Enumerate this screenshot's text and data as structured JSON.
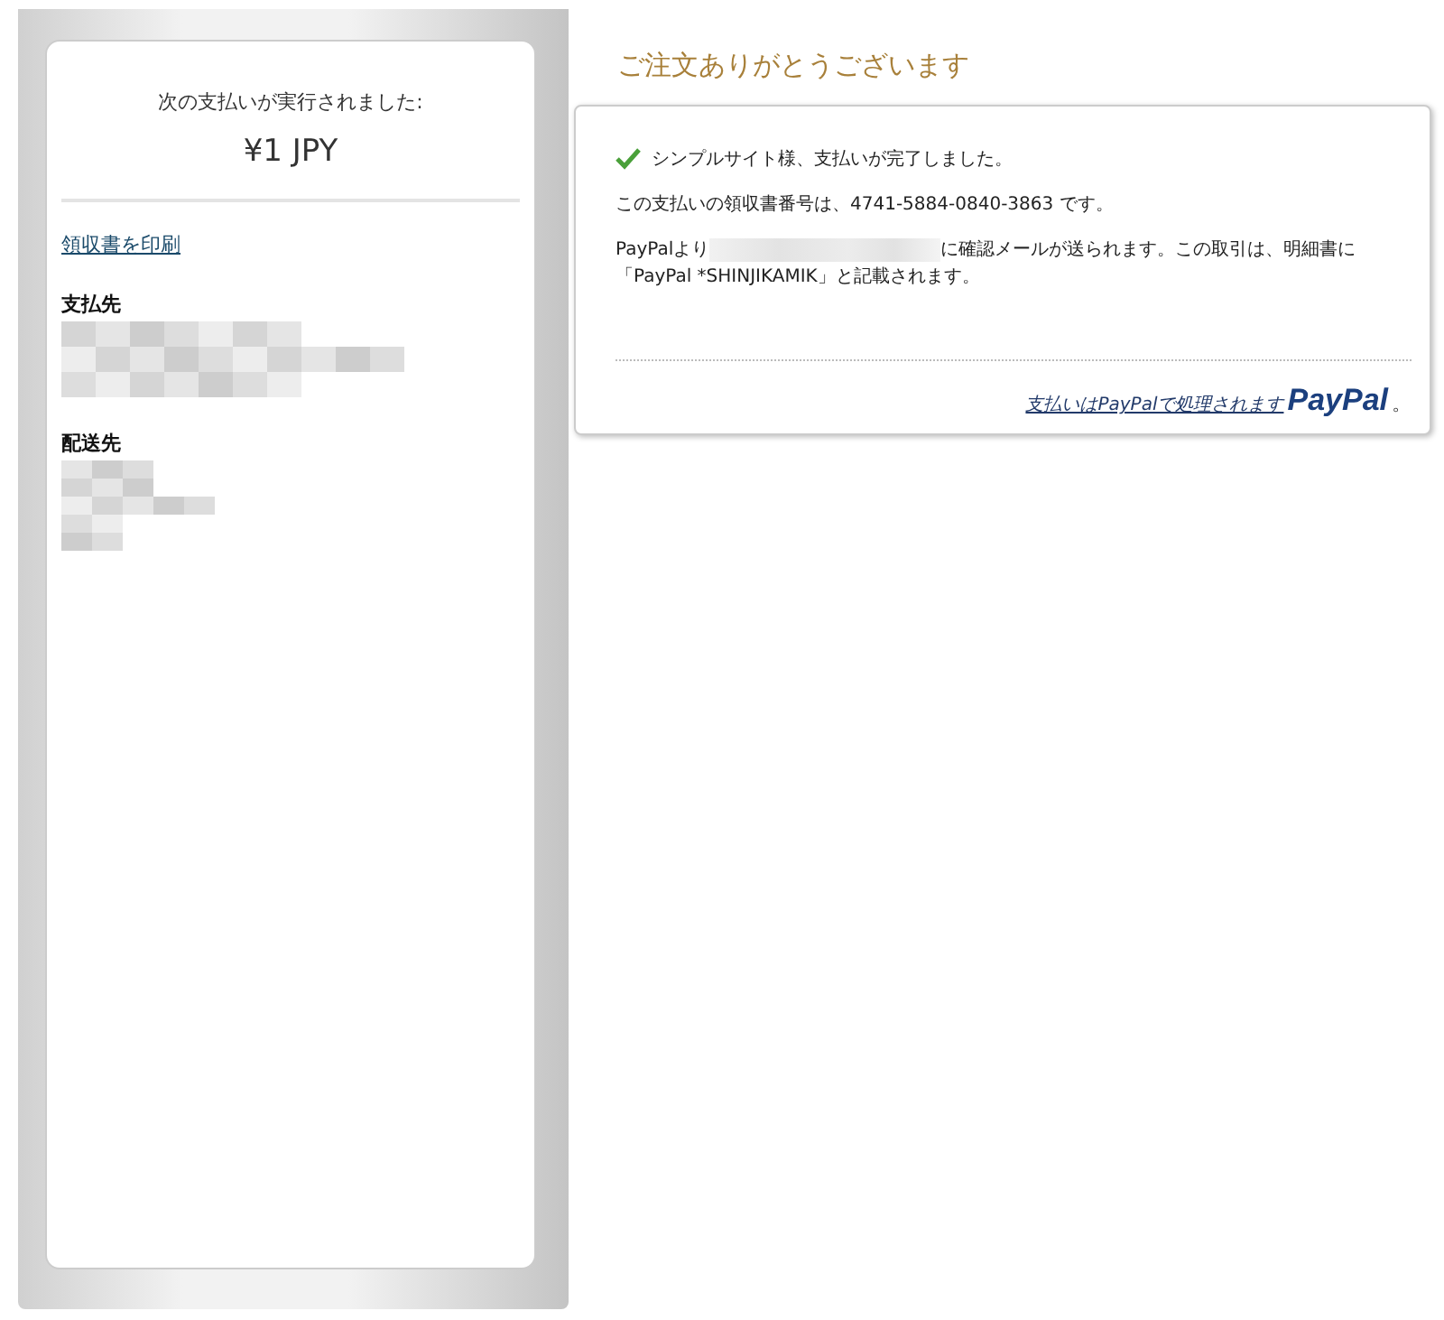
{
  "summary": {
    "heading": "次の支払いが実行されました:",
    "amount": "¥1 JPY",
    "print_link": "領収書を印刷",
    "payee_label": "支払先",
    "ship_label": "配送先"
  },
  "title": "ご注文ありがとうございます",
  "confirmation": {
    "success": "シンプルサイト様、支払いが完了しました。",
    "receipt": "この支払いの領収書番号は、4741-5884-0840-3863 です。",
    "mail_before": "PayPalより",
    "mail_after": "に確認メールが送られます。この取引は、明細書に",
    "statement": "「PayPal *SHINJIKAMIK」と記載されます。",
    "footer_link": "支払いはPayPalで処理されます",
    "logo": "PayPal",
    "logo_end": "。"
  }
}
